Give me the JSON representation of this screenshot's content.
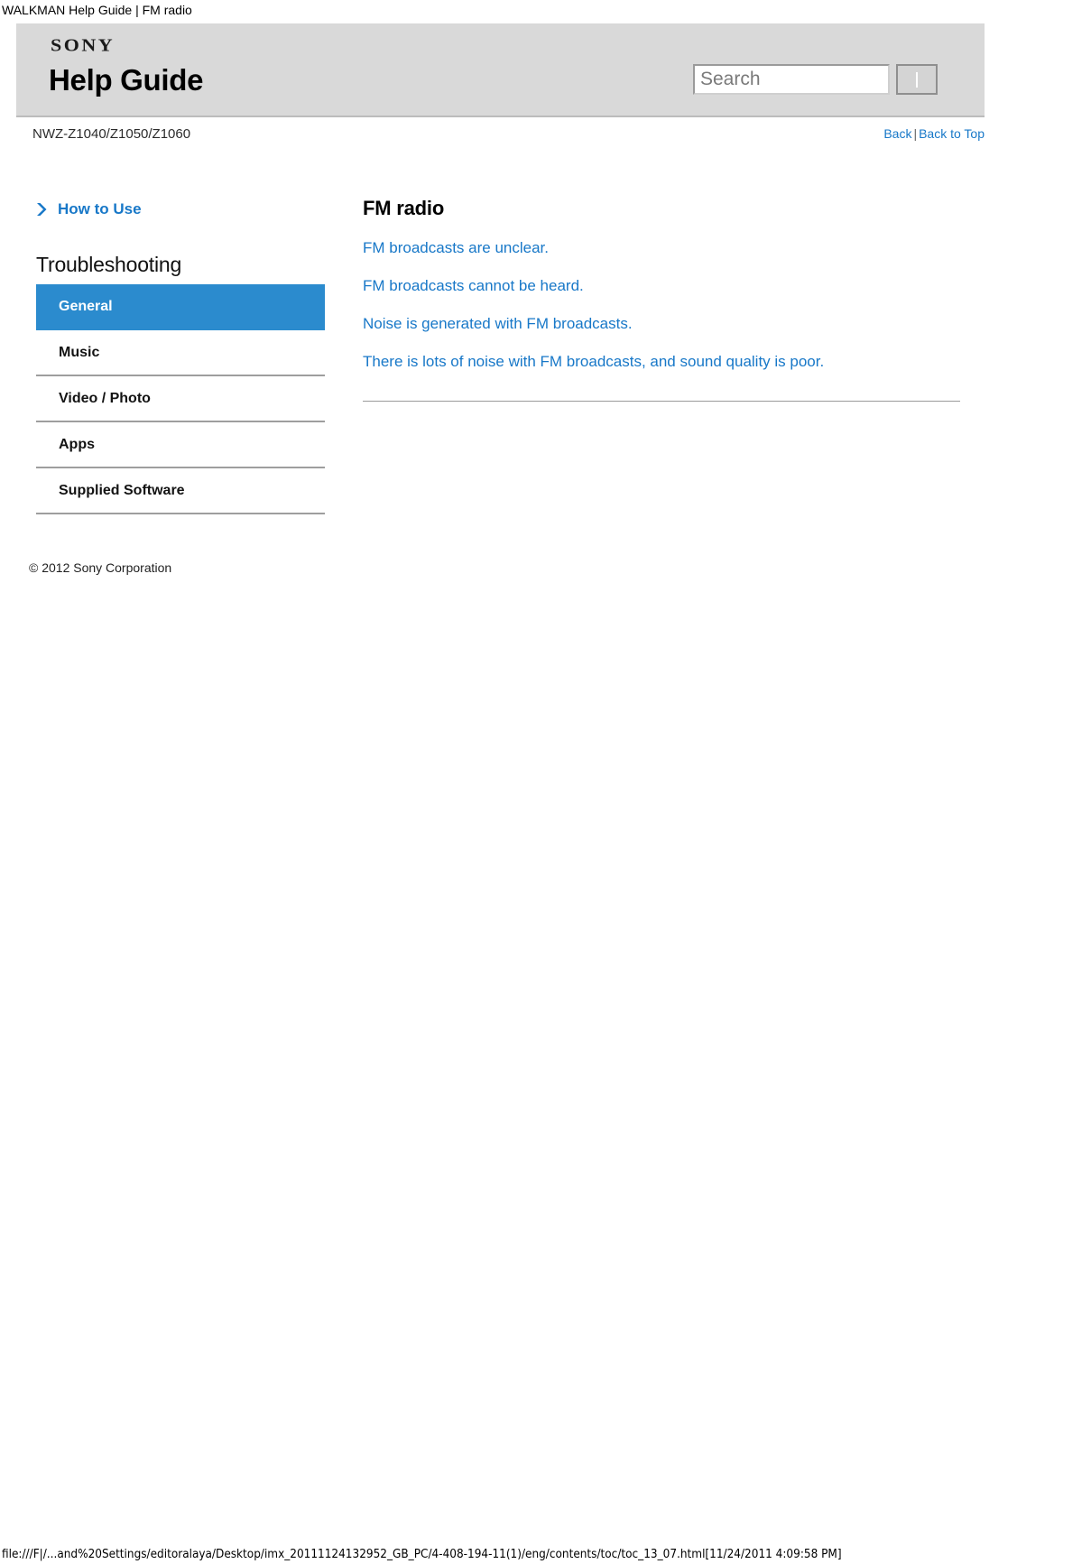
{
  "browser": {
    "page_title": "WALKMAN Help Guide | FM radio",
    "status_bar": "file:///F|/...and%20Settings/editoralaya/Desktop/imx_20111124132952_GB_PC/4-408-194-11(1)/eng/contents/toc/toc_13_07.html[11/24/2011 4:09:58 PM]"
  },
  "header": {
    "brand": "SONY",
    "title": "Help Guide",
    "model": "NWZ-Z1040/Z1050/Z1060",
    "search": {
      "placeholder": "Search",
      "value": "",
      "button_label": ""
    },
    "nav": {
      "back": "Back",
      "separator": "|",
      "back_to_top": "Back to Top"
    }
  },
  "sidebar": {
    "how_to_use": {
      "label": "How to Use",
      "icon": "chevron-right-icon"
    },
    "section_heading": "Troubleshooting",
    "items": [
      {
        "label": "General",
        "active": true
      },
      {
        "label": "Music",
        "active": false
      },
      {
        "label": "Video / Photo",
        "active": false
      },
      {
        "label": "Apps",
        "active": false
      },
      {
        "label": "Supplied Software",
        "active": false
      }
    ],
    "copyright": "© 2012 Sony Corporation"
  },
  "content": {
    "title": "FM radio",
    "links": [
      "FM broadcasts are unclear.",
      "FM broadcasts cannot be heard.",
      "Noise is generated with FM broadcasts.",
      "There is lots of noise with FM broadcasts, and sound quality is poor."
    ]
  },
  "colors": {
    "accent_blue": "#1878c8",
    "active_blue": "#2b8bce",
    "header_gray": "#d9d9d9"
  }
}
